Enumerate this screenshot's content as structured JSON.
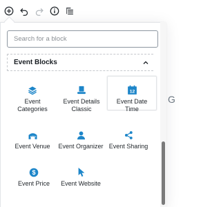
{
  "toolbar": {
    "buttons": [
      {
        "name": "add-block",
        "icon": "plus-circle-icon"
      },
      {
        "name": "undo",
        "icon": "undo-icon"
      },
      {
        "name": "redo",
        "icon": "redo-icon"
      },
      {
        "name": "info",
        "icon": "info-icon"
      },
      {
        "name": "navigation",
        "icon": "list-icon"
      }
    ]
  },
  "inserter": {
    "search_placeholder": "Search for a block",
    "panel": {
      "title": "Event Blocks",
      "collapse_icon": "chevron-up-icon"
    },
    "blocks": [
      {
        "label": "Event Categories",
        "line1": "Event",
        "line2": "Categories",
        "icon": "layers-icon"
      },
      {
        "label": "Event Details Classic",
        "line1": "Event Details",
        "line2": "Classic",
        "icon": "top-hat-icon"
      },
      {
        "label": "Event Date Time",
        "line1": "Event Date",
        "line2": "Time",
        "icon": "calendar-icon",
        "icon_text": "12"
      },
      {
        "label": "Event Venue",
        "line1": "Event Venue",
        "line2": "",
        "icon": "venue-icon"
      },
      {
        "label": "Event Organizer",
        "line1": "Event Organizer",
        "line2": "",
        "icon": "person-icon"
      },
      {
        "label": "Event Sharing",
        "line1": "Event Sharing",
        "line2": "",
        "icon": "share-icon"
      },
      {
        "label": "Event Price",
        "line1": "Event Price",
        "line2": "",
        "icon": "dollar-icon"
      },
      {
        "label": "Event Website",
        "line1": "Event Website",
        "line2": "",
        "icon": "cursor-icon"
      }
    ]
  },
  "background": {
    "partial_text": "G"
  },
  "colors": {
    "icon_blue": "#1e86c9",
    "text": "#23282d",
    "border": "#e2e4e7"
  }
}
